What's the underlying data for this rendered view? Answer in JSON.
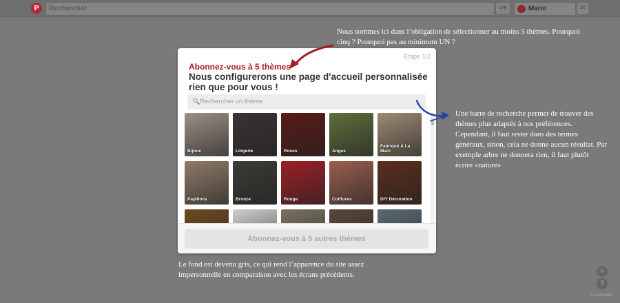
{
  "topbar": {
    "logo": "P",
    "search_placeholder": "Rechercher",
    "menu_icon": "≡▾",
    "user_name": "Marie",
    "message_icon": "✉"
  },
  "modal": {
    "step": "Etape 1/2",
    "title": "Abonnez-vous à 5 thèmes",
    "subtitle": "Nous configurerons une page d'accueil personnalisée rien que pour vous !",
    "search_placeholder": "Rechercher un thème",
    "search_icon": "🔍",
    "topics": [
      {
        "label": "Bijoux",
        "color": "#9c8f86"
      },
      {
        "label": "Lingerie",
        "color": "#3b3233"
      },
      {
        "label": "Roses",
        "color": "#5a1a16"
      },
      {
        "label": "Anges",
        "color": "#5e6e3a"
      },
      {
        "label": "Fabriqué À La Main",
        "color": "#9c8a73"
      },
      {
        "label": "Papillons",
        "color": "#8f7b69"
      },
      {
        "label": "Bronze",
        "color": "#3b3a35"
      },
      {
        "label": "Rouge",
        "color": "#9c2026"
      },
      {
        "label": "Coiffures",
        "color": "#9a5e4f"
      },
      {
        "label": "DIY Décoration",
        "color": "#5a2e1d"
      },
      {
        "label": "",
        "color": "#6e4a1f"
      },
      {
        "label": "",
        "color": "#cfcfcf"
      },
      {
        "label": "",
        "color": "#7b7360"
      },
      {
        "label": "",
        "color": "#5a463a"
      },
      {
        "label": "",
        "color": "#5a6a73"
      }
    ],
    "follow_button": "Abonnez-vous à 5 autres thèmes"
  },
  "annotations": {
    "top": "Nous sommes ici dans l’obligation de sélectionner au moins 5 thèmes. Pourquoi cinq ? Pourquoi pas au minimum UN ?",
    "right": "Une barre de recherche permet de trouver des thèmes plus adaptés à nos préférences. Cependant, il faut rester dans des termes généraux, sinon, cela ne donne aucun résultat. Par exemple arbre ne donnera rien, il faut plutôt écrire «nature»",
    "bottom": "Le fond est devenu gris, ce qui rend l’apparence du site assez impersonnelle en comparaison avec les écrans précédents."
  },
  "side": {
    "plus": "+",
    "help": "?",
    "tiny": "Confidentialité"
  },
  "colors": {
    "overlay": "#7a7a7a",
    "title_red": "#a61c24",
    "arrow_red": "#a31d22",
    "arrow_blue": "#2346a8"
  }
}
